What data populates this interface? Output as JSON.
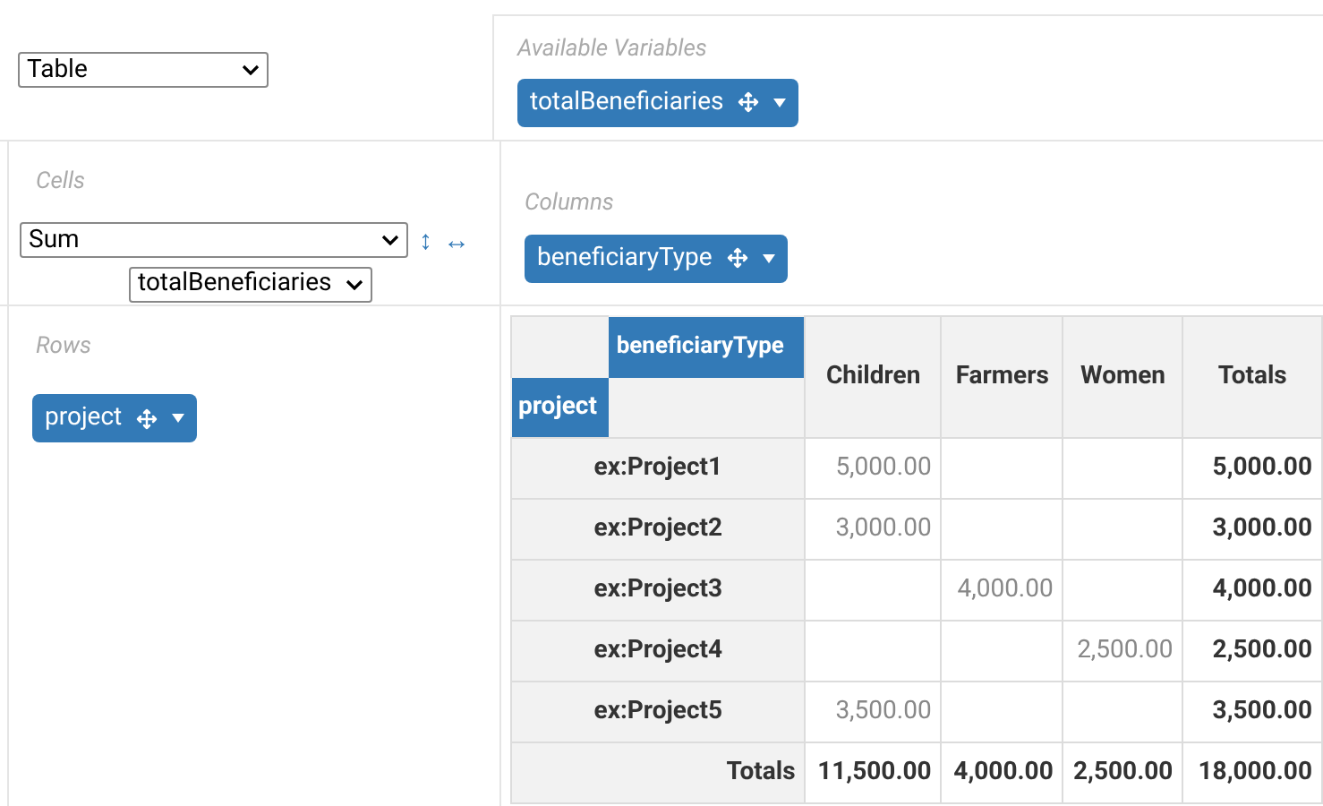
{
  "renderer_select": {
    "value": "Table"
  },
  "available_variables": {
    "label": "Available Variables",
    "chips": [
      {
        "label": "totalBeneficiaries"
      }
    ]
  },
  "cells": {
    "label": "Cells",
    "aggregator_select": {
      "value": "Sum"
    },
    "attribute_select": {
      "value": "totalBeneficiaries"
    },
    "row_order": "↕",
    "col_order": "↔"
  },
  "columns": {
    "label": "Columns",
    "chips": [
      {
        "label": "beneficiaryType"
      }
    ]
  },
  "rows": {
    "label": "Rows",
    "chips": [
      {
        "label": "project"
      }
    ]
  },
  "table": {
    "col_attribute": "beneficiaryType",
    "row_attribute": "project",
    "columns": [
      "Children",
      "Farmers",
      "Women",
      "Totals"
    ],
    "rows": [
      {
        "label": "ex:Project1",
        "cells": [
          "5,000.00",
          "",
          "",
          "5,000.00"
        ]
      },
      {
        "label": "ex:Project2",
        "cells": [
          "3,000.00",
          "",
          "",
          "3,000.00"
        ]
      },
      {
        "label": "ex:Project3",
        "cells": [
          "",
          "4,000.00",
          "",
          "4,000.00"
        ]
      },
      {
        "label": "ex:Project4",
        "cells": [
          "",
          "",
          "2,500.00",
          "2,500.00"
        ]
      },
      {
        "label": "ex:Project5",
        "cells": [
          "3,500.00",
          "",
          "",
          "3,500.00"
        ]
      }
    ],
    "totals": {
      "label": "Totals",
      "cells": [
        "11,500.00",
        "4,000.00",
        "2,500.00",
        "18,000.00"
      ]
    }
  }
}
